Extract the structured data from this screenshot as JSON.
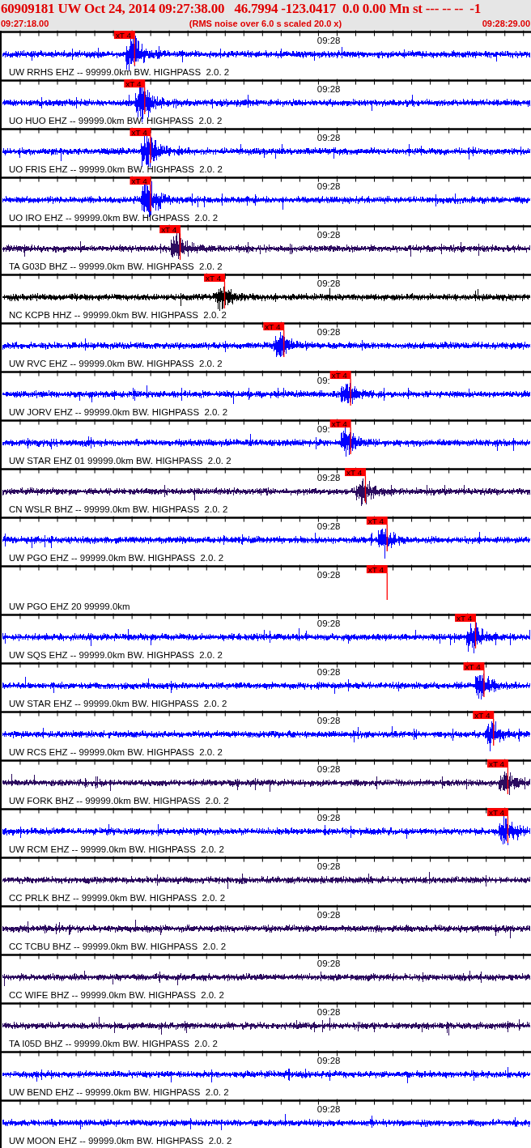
{
  "header": {
    "title": "60909181 UW Oct 24, 2014 09:27:38.00   46.7994 -123.0417  0.0 0.00 Mn st --- -- --  -1",
    "start_time": "09:27:18.00",
    "note": "(RMS noise over 6.0 s scaled 20.0 x)",
    "end_time": "09:28:29.00"
  },
  "traces": [
    {
      "kind": "waveform",
      "label": "UW RRHS EHZ -- 99999.0km BW. HIGHPASS  2.0. 2",
      "time_label": "09:28",
      "color": "#0000ff",
      "pick": {
        "label": "xT 4",
        "level": 0.252
      }
    },
    {
      "kind": "waveform",
      "label": "UO HUO EHZ -- 99999.0km BW. HIGHPASS  2.0. 2",
      "time_label": "09:28",
      "color": "#0000ff",
      "pick": {
        "label": "xT 4",
        "level": 0.271
      }
    },
    {
      "kind": "waveform",
      "label": "UO FRIS EHZ -- 99999.0km BW. HIGHPASS  2.0. 2",
      "time_label": "09:28",
      "color": "#0000ff",
      "pick": {
        "label": "xT 4",
        "level": 0.282
      }
    },
    {
      "kind": "waveform",
      "label": "UO IRO EHZ -- 99999.0km BW. HIGHPASS  2.0. 2",
      "time_label": "09:28",
      "color": "#0000ff",
      "pick": {
        "label": "xT 4",
        "level": 0.282
      }
    },
    {
      "kind": "waveform",
      "label": "TA G03D BHZ -- 99999.0km BW. HIGHPASS  2.0. 2",
      "time_label": "09:28",
      "color": "#2b0a5e",
      "pick": {
        "label": "xT 4",
        "level": 0.338
      }
    },
    {
      "kind": "waveform",
      "label": "NC KCPB HHZ -- 99999.0km BW. HIGHPASS  2.0. 2",
      "time_label": "09:28",
      "color": "#000000",
      "pick": {
        "label": "xT 4",
        "level": 0.422
      }
    },
    {
      "kind": "waveform",
      "label": "UW RVC EHZ -- 99999.0km BW. HIGHPASS  2.0. 2",
      "time_label": "09:28",
      "color": "#0000ff",
      "pick": {
        "label": "xT 4",
        "level": 0.534
      }
    },
    {
      "kind": "waveform",
      "label": "UW JORV EHZ -- 99999.0km BW. HIGHPASS  2.0. 2",
      "time_label": "09:",
      "color": "#0000ff",
      "pick": {
        "label": "xT 4",
        "level": 0.66
      }
    },
    {
      "kind": "waveform",
      "label": "UW STAR EHZ 01 99999.0km BW. HIGHPASS  2.0. 2",
      "time_label": "09:",
      "color": "#0000ff",
      "pick": {
        "label": "xT 4",
        "level": 0.66
      }
    },
    {
      "kind": "waveform",
      "label": "CN WSLR BHZ -- 99999.0km BW. HIGHPASS  2.0. 2",
      "time_label": "09:28",
      "color": "#2b0a5e",
      "pick": {
        "label": "xT 4",
        "level": 0.688
      }
    },
    {
      "kind": "waveform",
      "label": "UW PGO EHZ -- 99999.0km BW. HIGHPASS  2.0. 2",
      "time_label": "09:28",
      "color": "#0000ff",
      "pick": {
        "label": "xT 4",
        "level": 0.729
      }
    },
    {
      "kind": "blank",
      "label": "UW PGO EHZ 20 99999.0km",
      "time_label": "09:28",
      "pick": {
        "label": "xT 4",
        "level": 0.729
      }
    },
    {
      "kind": "waveform",
      "label": "UW SQS EHZ -- 99999.0km BW. HIGHPASS  2.0. 2",
      "time_label": "09:28",
      "color": "#0000ff",
      "pick": {
        "label": "xT 4",
        "level": 0.896
      }
    },
    {
      "kind": "waveform",
      "label": "UW STAR EHZ -- 99999.0km BW. HIGHPASS  2.0. 2",
      "time_label": "09:28",
      "color": "#0000ff",
      "pick": {
        "label": "xT 4",
        "level": 0.912
      }
    },
    {
      "kind": "waveform",
      "label": "UW RCS EHZ -- 99999.0km BW. HIGHPASS  2.0. 2",
      "time_label": "09:28",
      "color": "#0000ff",
      "pick": {
        "label": "xT 4",
        "level": 0.93
      }
    },
    {
      "kind": "waveform",
      "label": "UW FORK BHZ -- 99999.0km BW. HIGHPASS  2.0. 2",
      "time_label": "09:28",
      "color": "#2b0a5e",
      "pick": {
        "label": "xT 4",
        "level": 0.957
      }
    },
    {
      "kind": "waveform",
      "label": "UW RCM EHZ -- 99999.0km BW. HIGHPASS  2.0. 2",
      "time_label": "09:28",
      "color": "#0000ff",
      "pick": {
        "label": "xT 4",
        "level": 0.957
      }
    },
    {
      "kind": "waveform",
      "label": "CC PRLK BHZ -- 99999.0km BW. HIGHPASS  2.0. 2",
      "time_label": "09:28",
      "color": "#2b0a5e"
    },
    {
      "kind": "waveform",
      "label": "CC TCBU BHZ -- 99999.0km BW. HIGHPASS  2.0. 2",
      "time_label": "09:28",
      "color": "#2b0a5e"
    },
    {
      "kind": "waveform",
      "label": "CC WIFE BHZ -- 99999.0km BW. HIGHPASS  2.0. 2",
      "time_label": "09:28",
      "color": "#2b0a5e"
    },
    {
      "kind": "waveform",
      "label": "TA I05D BHZ -- 99999.0km BW. HIGHPASS  2.0. 2",
      "time_label": "09:28",
      "color": "#2b0a5e"
    },
    {
      "kind": "waveform",
      "label": "UW BEND EHZ -- 99999.0km BW. HIGHPASS  2.0. 2",
      "time_label": "09:28",
      "color": "#0000ff"
    },
    {
      "kind": "waveform",
      "label": "UW MOON EHZ -- 99999.0km BW. HIGHPASS  2.0. 2",
      "time_label": "09:28",
      "color": "#0000ff"
    }
  ]
}
